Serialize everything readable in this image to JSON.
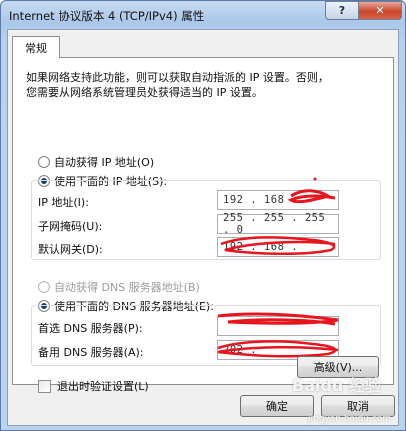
{
  "window": {
    "title": "Internet 协议版本 4 (TCP/IPv4) 属性",
    "help_label": "?",
    "close_label": "✕"
  },
  "tabs": [
    {
      "label": "常规"
    }
  ],
  "intro": {
    "line1": "如果网络支持此功能，则可以获取自动指派的 IP 设置。否则，",
    "line2": "您需要从网络系统管理员处获得适当的 IP 设置。"
  },
  "ip": {
    "auto_label": "自动获得 IP 地址(O)",
    "manual_label": "使用下面的 IP 地址(S):",
    "selected": "manual",
    "address_label": "IP 地址(I):",
    "address_value": "192 . 168 .",
    "subnet_label": "子网掩码(U):",
    "subnet_value": "255 . 255 . 255 .  0",
    "gateway_label": "默认网关(D):",
    "gateway_value": "192 . 168 ."
  },
  "dns": {
    "auto_label": "自动获得 DNS 服务器地址(B)",
    "manual_label": "使用下面的 DNS 服务器地址(E):",
    "selected": "manual",
    "preferred_label": "首选 DNS 服务器(P):",
    "preferred_value": "",
    "alternate_label": "备用 DNS 服务器(A):",
    "alternate_value": "202 ."
  },
  "validate": {
    "label": "退出时验证设置(L)",
    "checked": false
  },
  "buttons": {
    "advanced": "高级(V)...",
    "ok": "确定",
    "cancel": "取消"
  },
  "watermark": {
    "brand": "Baidu 经验",
    "url": "jingyan.baidu.com"
  },
  "colors": {
    "redaction": "#e8141e",
    "title_gradient": "#aac7e9",
    "close_button": "#c9452c"
  }
}
